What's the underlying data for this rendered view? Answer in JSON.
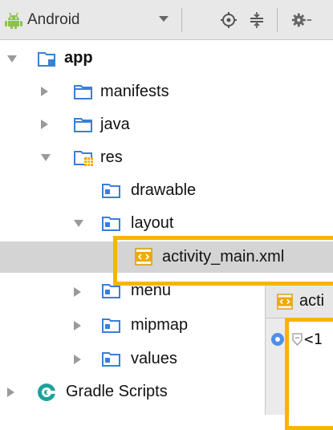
{
  "toolbar": {
    "view_label": "Android",
    "icons": [
      "android-icon",
      "target-icon",
      "collapse-icon",
      "gear-icon"
    ]
  },
  "tree": {
    "app": "app",
    "manifests": "manifests",
    "java": "java",
    "res": "res",
    "drawable": "drawable",
    "layout": "layout",
    "activity_main": "activity_main.xml",
    "menu": "menu",
    "mipmap": "mipmap",
    "values": "values",
    "gradle": "Gradle Scripts"
  },
  "editor": {
    "tab_label": "acti",
    "code_text": "<1"
  },
  "colors": {
    "highlight": "#f7b500",
    "selection": "#d4d4d4",
    "folder": "#3a7fd5",
    "android": "#8bc34a",
    "gradle": "#1ba39c"
  }
}
